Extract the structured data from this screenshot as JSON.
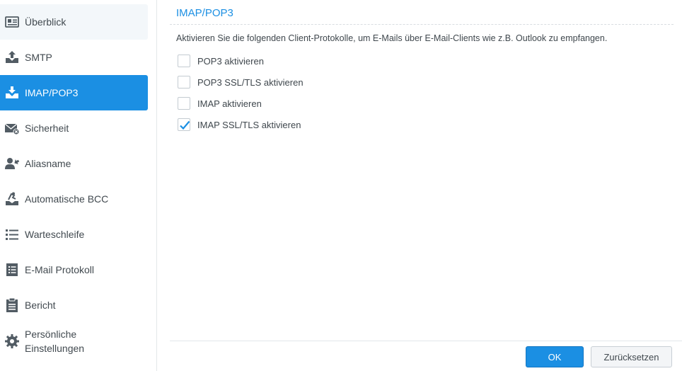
{
  "sidebar": {
    "items": [
      {
        "label": "Überblick",
        "icon": "overview-icon"
      },
      {
        "label": "SMTP",
        "icon": "outbox-icon"
      },
      {
        "label": "IMAP/POP3",
        "icon": "inbox-icon"
      },
      {
        "label": "Sicherheit",
        "icon": "mail-security-icon"
      },
      {
        "label": "Aliasname",
        "icon": "alias-icon"
      },
      {
        "label": "Automatische BCC",
        "icon": "auto-bcc-icon"
      },
      {
        "label": "Warteschleife",
        "icon": "queue-list-icon"
      },
      {
        "label": "E-Mail Protokoll",
        "icon": "log-icon"
      },
      {
        "label": "Bericht",
        "icon": "report-clipboard-icon"
      },
      {
        "label": "Persönliche Einstellungen",
        "icon": "gear-icon"
      }
    ],
    "active_index": 2
  },
  "main": {
    "title": "IMAP/POP3",
    "description": "Aktivieren Sie die folgenden Client-Protokolle, um E-Mails über E-Mail-Clients wie z.B. Outlook zu empfangen.",
    "options": [
      {
        "label": "POP3 aktivieren",
        "checked": false
      },
      {
        "label": "POP3 SSL/TLS aktivieren",
        "checked": false
      },
      {
        "label": "IMAP aktivieren",
        "checked": false
      },
      {
        "label": "IMAP SSL/TLS aktivieren",
        "checked": true
      }
    ]
  },
  "footer": {
    "ok_label": "OK",
    "reset_label": "Zurücksetzen"
  },
  "colors": {
    "accent": "#1b8fe3",
    "sidebar_hover": "#f3f7fa",
    "icon": "#525c64"
  }
}
